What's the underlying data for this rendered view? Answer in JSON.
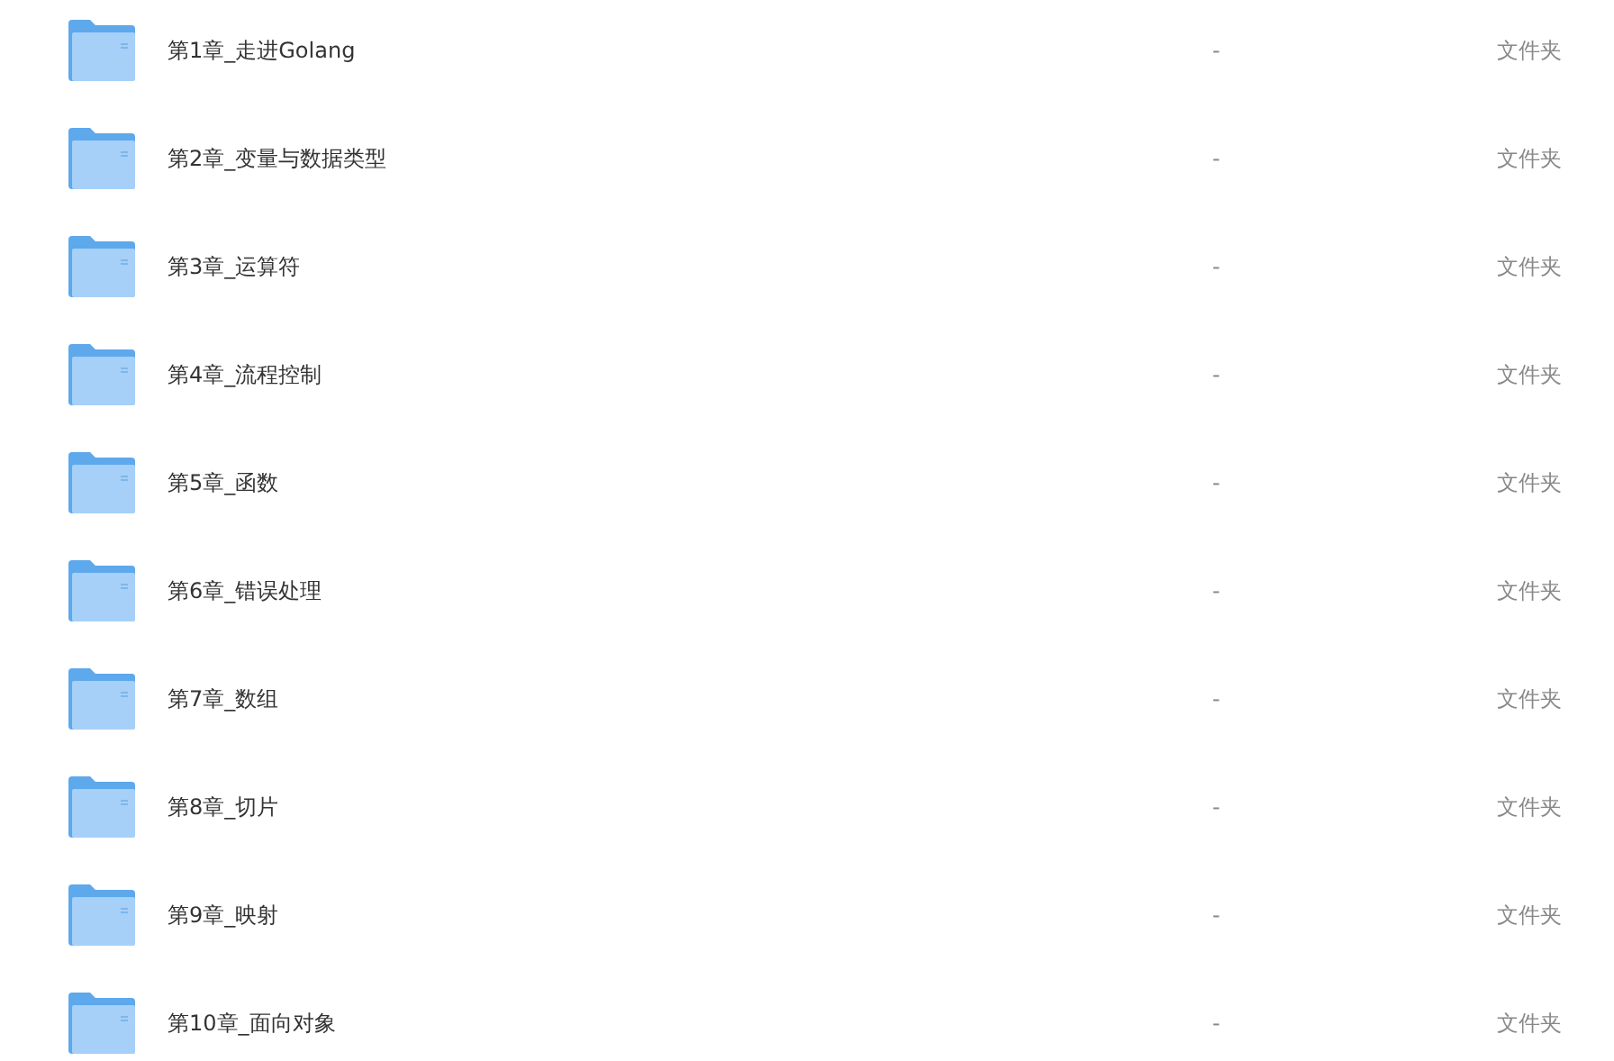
{
  "files": [
    {
      "name": "第1章_走进Golang",
      "size": "-",
      "type": "文件夹"
    },
    {
      "name": "第2章_变量与数据类型",
      "size": "-",
      "type": "文件夹"
    },
    {
      "name": "第3章_运算符",
      "size": "-",
      "type": "文件夹"
    },
    {
      "name": "第4章_流程控制",
      "size": "-",
      "type": "文件夹"
    },
    {
      "name": "第5章_函数",
      "size": "-",
      "type": "文件夹"
    },
    {
      "name": "第6章_错误处理",
      "size": "-",
      "type": "文件夹"
    },
    {
      "name": "第7章_数组",
      "size": "-",
      "type": "文件夹"
    },
    {
      "name": "第8章_切片",
      "size": "-",
      "type": "文件夹"
    },
    {
      "name": "第9章_映射",
      "size": "-",
      "type": "文件夹"
    },
    {
      "name": "第10章_面向对象",
      "size": "-",
      "type": "文件夹"
    }
  ]
}
